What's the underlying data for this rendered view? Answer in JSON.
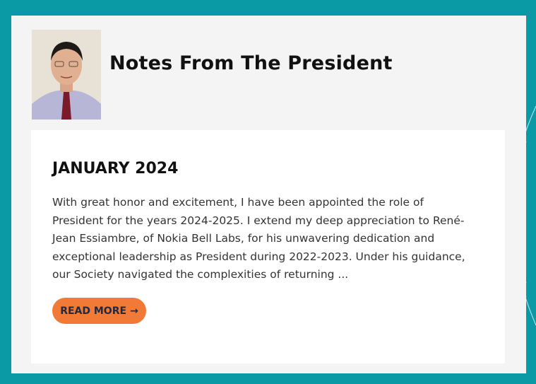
{
  "header": {
    "title": "Notes From The President",
    "avatar_icon": "president-portrait"
  },
  "article": {
    "date": "JANUARY 2024",
    "excerpt": "With great honor and excitement, I have been appointed the role of President for the years 2024-2025. I extend my deep appreciation to René-Jean Essiambre, of Nokia Bell Labs, for his unwavering dedication and exceptional leadership as President during 2022-2023. Under his guidance, our Society navigated the complexities of returning ...",
    "read_more_label": "READ MORE",
    "read_more_arrow": "→"
  },
  "colors": {
    "background": "#0a9aa6",
    "panel": "#f4f4f4",
    "button": "#f07a36",
    "button_text": "#1f2a44"
  }
}
